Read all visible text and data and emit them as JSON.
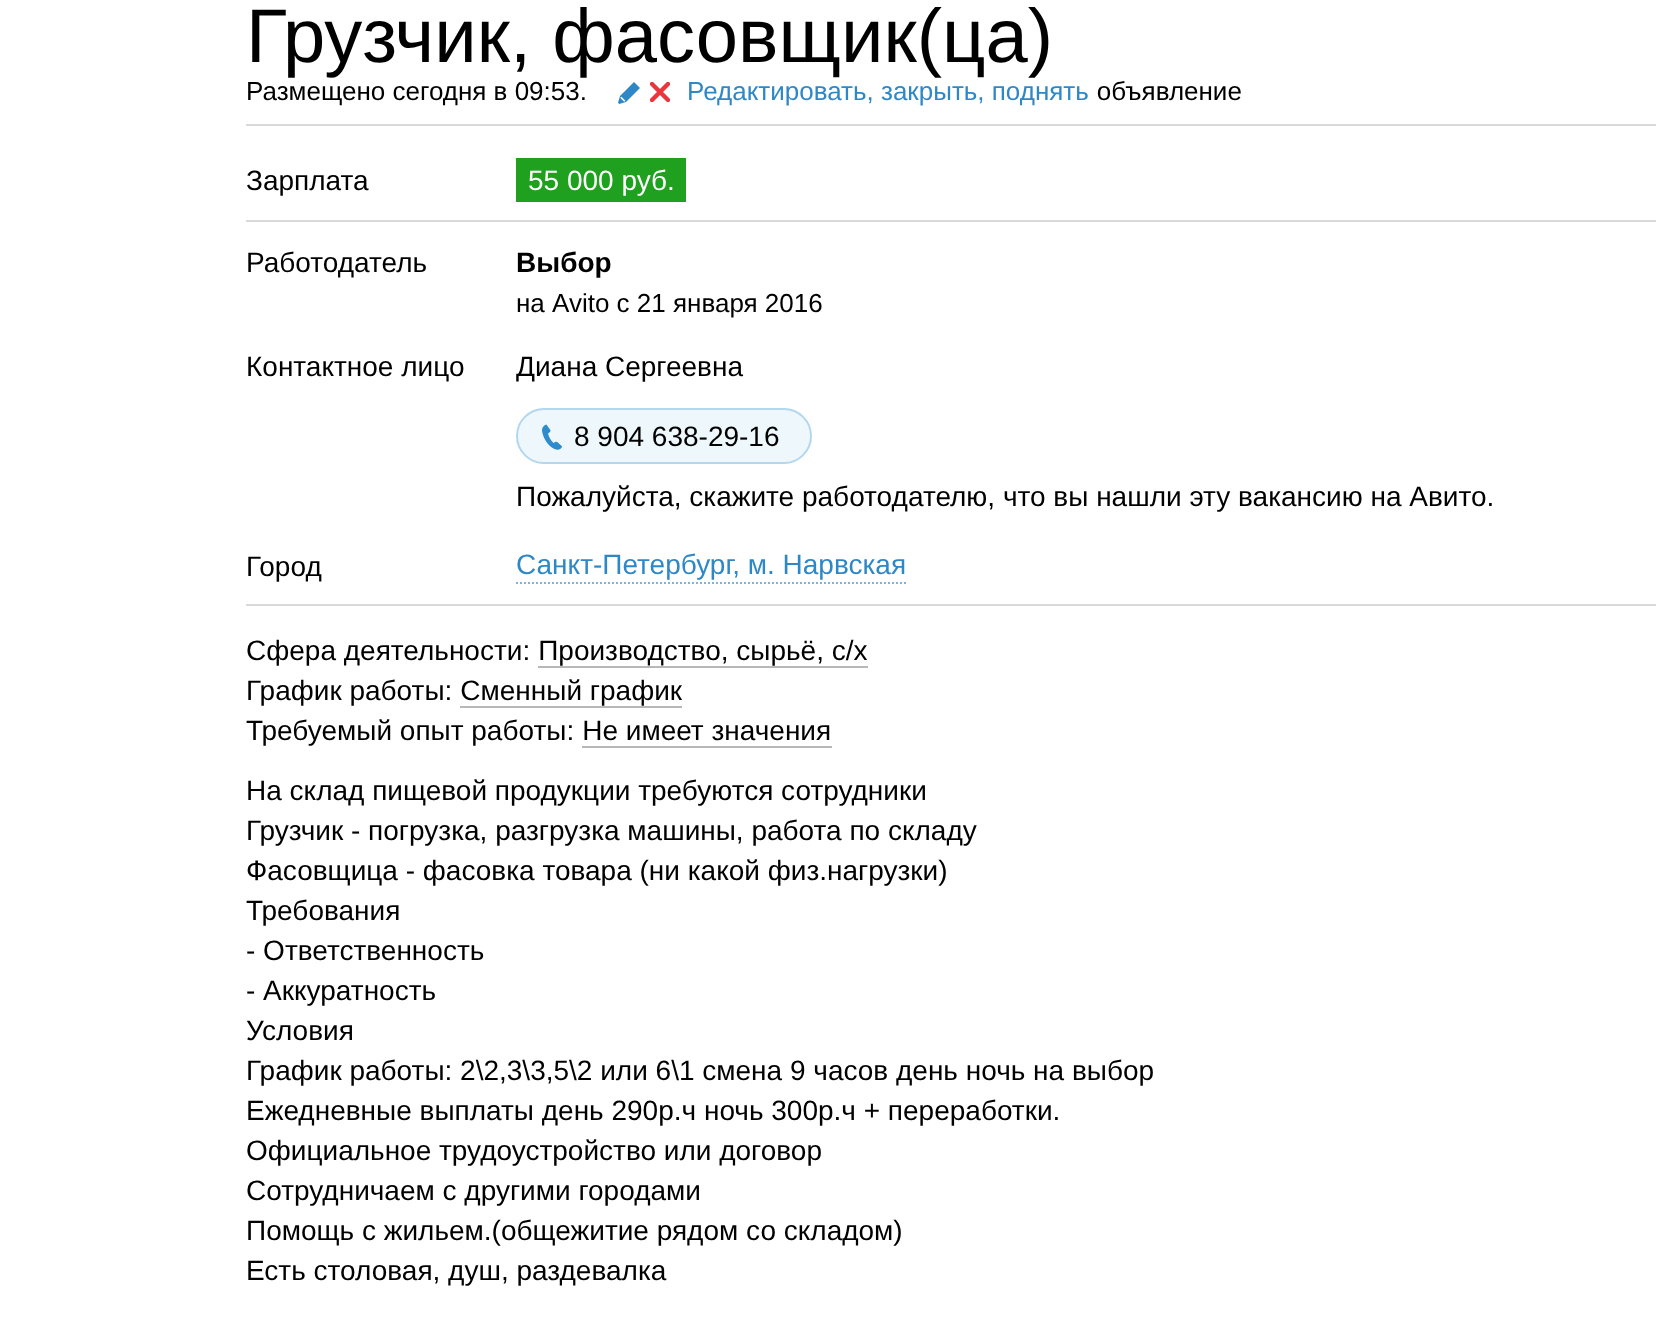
{
  "header": {
    "title": "Грузчик, фасовщик(ца)",
    "posted": "Размещено сегодня в 09:53.",
    "manage_link": "Редактировать, закрыть, поднять",
    "manage_suffix": "объявление"
  },
  "sections": [
    {
      "rows": [
        {
          "kind": "badge",
          "label": "Зарплата",
          "value": "55 000 руб."
        }
      ]
    },
    {
      "rows": [
        {
          "kind": "employer",
          "label": "Работодатель",
          "name": "Выбор",
          "since": "на Avito с 21 января 2016"
        },
        {
          "kind": "contact",
          "label": "Контактное лицо",
          "name": "Диана Сергеевна",
          "phone": "8 904 638-29-16",
          "note": "Пожалуйста, скажите работодателю, что вы нашли эту вакансию на Авито."
        },
        {
          "kind": "link",
          "label": "Город",
          "value": "Санкт-Петербург, м. Нарвская"
        }
      ]
    }
  ],
  "parameters": [
    {
      "label": "Сфера деятельности:",
      "value": "Производство, сырьё, с/х"
    },
    {
      "label": "График работы:",
      "value": "Сменный график"
    },
    {
      "label": "Требуемый опыт работы:",
      "value": "Не имеет значения"
    }
  ],
  "description": [
    "На склад пищевой продукции требуются сотрудники",
    "Грузчик - погрузка, разгрузка машины, работа по складу",
    "Фасовщица - фасовка товара (ни какой физ.нагрузки)",
    "Требования",
    "- Ответственность",
    "- Аккуратность",
    "Условия",
    "График работы: 2\\2,3\\3,5\\2 или 6\\1 смена 9 часов день ночь на выбор",
    "Ежедневные выплаты день 290р.ч ночь 300р.ч + переработки.",
    "Официальное трудоустройство или договор",
    "Сотрудничаем с другими городами",
    "Помощь с жильем.(общежитие рядом со складом)",
    "Есть столовая, душ, раздевалка"
  ]
}
